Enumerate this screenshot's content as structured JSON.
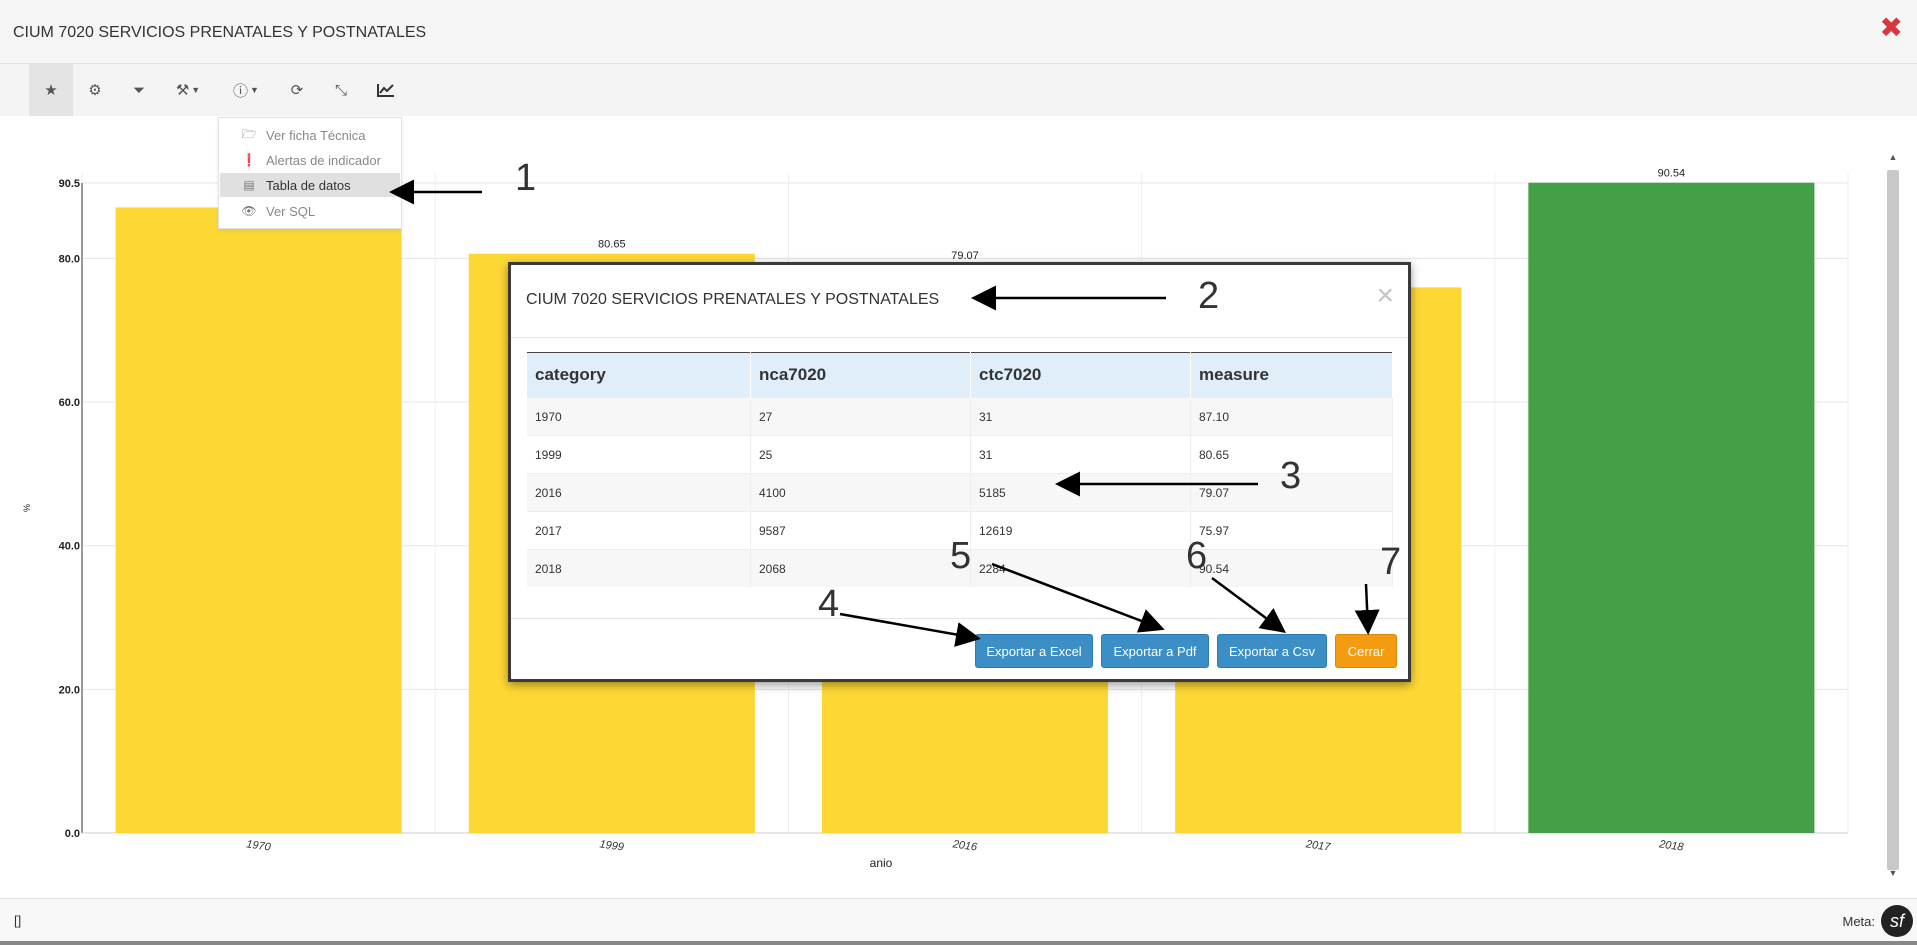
{
  "window": {
    "title": "CIUM 7020 SERVICIOS PRENATALES Y POSTNATALES"
  },
  "toolbar": {
    "buttons": [
      {
        "name": "favorite-button",
        "icon": "star-icon",
        "glyph": "★"
      },
      {
        "name": "settings-button",
        "icon": "gear-icon",
        "glyph": "⚙"
      },
      {
        "name": "filter-button",
        "icon": "filter-icon",
        "glyph": "⏷"
      },
      {
        "name": "export-dropdown-button",
        "icon": "gavel-icon",
        "glyph": "⚒"
      },
      {
        "name": "info-dropdown-button",
        "icon": "info-circle-icon",
        "glyph": "ⓘ"
      },
      {
        "name": "refresh-button",
        "icon": "refresh-icon",
        "glyph": "⟳"
      },
      {
        "name": "compress-button",
        "icon": "compress-icon",
        "glyph": "⤡"
      },
      {
        "name": "chart-type-button",
        "icon": "line-chart-icon",
        "glyph": "📈"
      }
    ]
  },
  "dropdown": {
    "items": [
      {
        "label": "Ver ficha Técnica",
        "icon": "folder-open-icon",
        "glyph": "🗁"
      },
      {
        "label": "Alertas de indicador",
        "icon": "exclamation-circle-icon",
        "glyph": "❗"
      },
      {
        "label": "Tabla de datos",
        "icon": "table-icon",
        "glyph": "▤"
      },
      {
        "label": "Ver SQL",
        "icon": "eye-icon",
        "glyph": "👁"
      }
    ]
  },
  "chart_data": {
    "type": "bar",
    "categories": [
      "1970",
      "1999",
      "2016",
      "2017",
      "2018"
    ],
    "values": [
      87.1,
      80.65,
      79.07,
      75.97,
      90.54
    ],
    "value_labels": [
      "",
      "80.65",
      "79.07",
      "",
      "90.54"
    ],
    "bar_colors": [
      "#fdd835",
      "#fdd835",
      "#fdd835",
      "#fdd835",
      "#43a047"
    ],
    "xlabel": "anio",
    "ylabel": "%",
    "yticks": [
      "0.0",
      "20.0",
      "40.0",
      "60.0",
      "80.0",
      "90.5"
    ],
    "ytick_values": [
      0,
      20,
      40,
      60,
      80,
      90.5
    ],
    "ylim": [
      0,
      90.5
    ],
    "grid": true
  },
  "modal": {
    "title": "CIUM 7020 SERVICIOS PRENATALES Y POSTNATALES",
    "close_glyph": "×",
    "columns": [
      "category",
      "nca7020",
      "ctc7020",
      "measure"
    ],
    "rows": [
      [
        "1970",
        "27",
        "31",
        "87.10"
      ],
      [
        "1999",
        "25",
        "31",
        "80.65"
      ],
      [
        "2016",
        "4100",
        "5185",
        "79.07"
      ],
      [
        "2017",
        "9587",
        "12619",
        "75.97"
      ],
      [
        "2018",
        "2068",
        "2284",
        "90.54"
      ]
    ],
    "buttons": {
      "excel": "Exportar a Excel",
      "pdf": "Exportar a Pdf",
      "csv": "Exportar a Csv",
      "close": "Cerrar"
    }
  },
  "annotations": [
    "1",
    "2",
    "3",
    "4",
    "5",
    "6",
    "7"
  ],
  "footer": {
    "left_text": "[]",
    "meta_label": "Meta:",
    "logo_glyph": "sf"
  },
  "colors": {
    "close_red": "#d9363e",
    "btn_blue": "#3b8fc6",
    "btn_orange": "#f39c12"
  }
}
